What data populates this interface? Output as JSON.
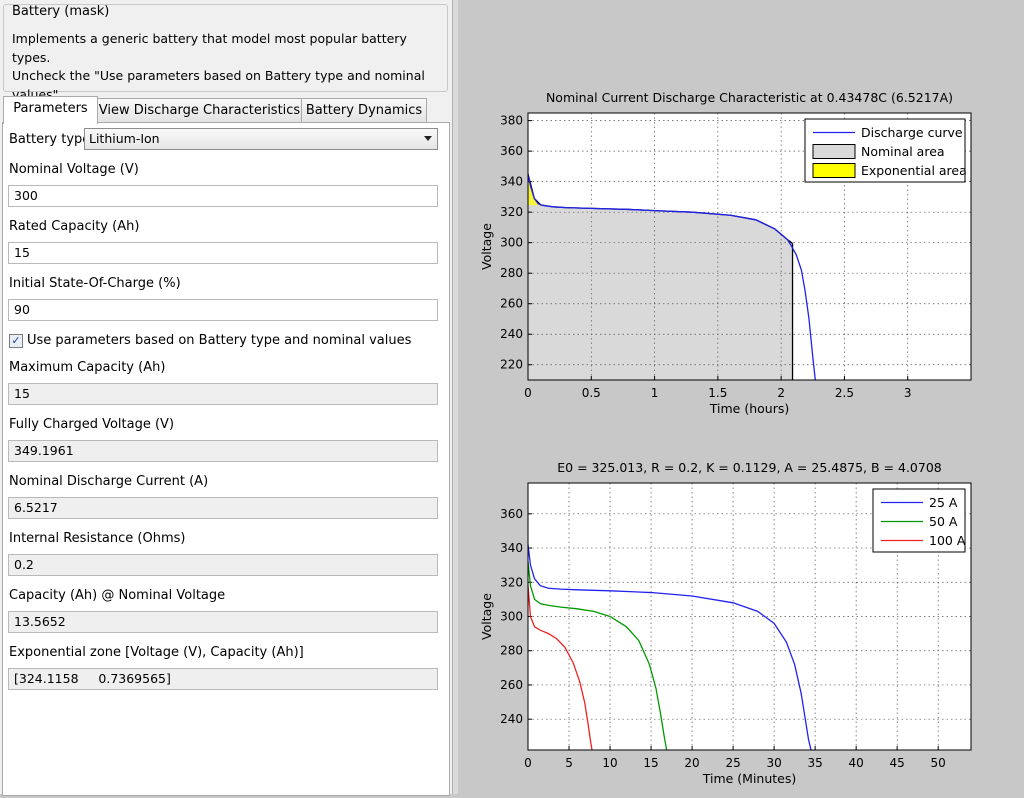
{
  "mask": {
    "title": "Battery (mask)",
    "description": "Implements a generic battery that model most popular battery types.\nUncheck the \"Use parameters based on Battery type and nominal values\"\nparameter to edit the discharge characteristics."
  },
  "tabs": [
    "Parameters",
    "View Discharge Characteristics",
    "Battery Dynamics"
  ],
  "params": {
    "battery_type_label": "Battery type",
    "battery_type_value": "Lithium-Ion",
    "nominal_voltage_label": "Nominal Voltage (V)",
    "nominal_voltage_value": "300",
    "rated_capacity_label": "Rated Capacity (Ah)",
    "rated_capacity_value": "15",
    "initial_soc_label": "Initial State-Of-Charge (%)",
    "initial_soc_value": "90",
    "use_params_label": "Use parameters based on Battery type and nominal values",
    "use_params_checked": true,
    "max_capacity_label": "Maximum Capacity (Ah)",
    "max_capacity_value": "15",
    "fully_charged_label": "Fully Charged Voltage (V)",
    "fully_charged_value": "349.1961",
    "nominal_current_label": "Nominal Discharge Current (A)",
    "nominal_current_value": "6.5217",
    "internal_resistance_label": "Internal Resistance (Ohms)",
    "internal_resistance_value": "0.2",
    "capacity_nominal_label": "Capacity (Ah) @ Nominal Voltage",
    "capacity_nominal_value": "13.5652",
    "exp_zone_label": "Exponential zone [Voltage (V), Capacity (Ah)]",
    "exp_zone_value": "[324.1158     0.7369565]"
  },
  "colors": {
    "blue": "#2222ee",
    "green": "#009900",
    "red": "#ee2222",
    "yellow": "#ffff00",
    "nominal_gray": "#d9d9d9"
  },
  "chart_data": [
    {
      "type": "line",
      "title": "Nominal Current Discharge Characteristic at 0.43478C (6.5217A)",
      "xlabel": "Time (hours)",
      "ylabel": "Voltage",
      "xlim": [
        0,
        3.5
      ],
      "ylim": [
        210,
        385
      ],
      "xticks": [
        0,
        0.5,
        1,
        1.5,
        2,
        2.5,
        3
      ],
      "yticks": [
        220,
        240,
        260,
        280,
        300,
        320,
        340,
        360,
        380
      ],
      "grid": true,
      "legend_position": "top-right",
      "legend": [
        {
          "label": "Discharge curve",
          "kind": "line",
          "color": "#2222ee"
        },
        {
          "label": "Nominal area",
          "kind": "box",
          "color": "#d9d9d9"
        },
        {
          "label": "Exponential area",
          "kind": "box",
          "color": "#ffff00"
        }
      ],
      "series": [
        {
          "name": "Discharge curve",
          "x": [
            0,
            0.02,
            0.05,
            0.08,
            0.11,
            0.15,
            0.2,
            0.3,
            0.5,
            0.8,
            1.0,
            1.3,
            1.6,
            1.8,
            1.95,
            2.05,
            2.08,
            2.12,
            2.16,
            2.19,
            2.22,
            2.25,
            2.27
          ],
          "y": [
            345,
            337,
            329,
            325.5,
            324.5,
            324,
            323.5,
            323,
            322.5,
            321.8,
            321,
            320,
            318,
            315,
            309,
            302,
            298,
            292,
            282,
            268,
            250,
            225,
            210
          ]
        }
      ],
      "exponential_area": {
        "x": [
          0,
          0.02,
          0.05,
          0.08,
          0.11
        ],
        "y": [
          345,
          337,
          329,
          325.5,
          324.5
        ]
      },
      "nominal_area": {
        "x": [
          0,
          0.05,
          0.1,
          0.2,
          0.3,
          0.5,
          0.8,
          1.0,
          1.3,
          1.6,
          1.8,
          1.95,
          2.05,
          2.09
        ],
        "y": [
          345,
          329,
          324.8,
          323.5,
          323,
          322.5,
          321.8,
          321,
          320,
          318,
          315,
          309,
          302,
          299.5
        ]
      },
      "nominal_capacity_marker_x": 2.09
    },
    {
      "type": "line",
      "title": "E0 = 325.013, R = 0.2, K = 0.1129, A = 25.4875, B = 4.0708",
      "xlabel": "Time (Minutes)",
      "ylabel": "Voltage",
      "xlim": [
        0,
        54
      ],
      "ylim": [
        222,
        378
      ],
      "xticks": [
        0,
        5,
        10,
        15,
        20,
        25,
        30,
        35,
        40,
        45,
        50
      ],
      "yticks": [
        240,
        260,
        280,
        300,
        320,
        340,
        360
      ],
      "grid": true,
      "legend_position": "top-right",
      "series": [
        {
          "name": "25 A",
          "color": "#2222ee",
          "x": [
            0,
            0.3,
            0.8,
            1.5,
            2.5,
            4,
            6,
            10,
            15,
            20,
            25,
            28,
            30,
            31.5,
            32.5,
            33.3,
            33.8,
            34.2,
            34.5
          ],
          "y": [
            342,
            330,
            322,
            318,
            316.5,
            316,
            315.6,
            315,
            314,
            312,
            308,
            303,
            296,
            285,
            272,
            255,
            240,
            228,
            222
          ]
        },
        {
          "name": "50 A",
          "color": "#009900",
          "x": [
            0,
            0.3,
            0.8,
            1.5,
            2.5,
            4,
            6,
            8,
            10,
            12,
            13.5,
            14.8,
            15.6,
            16.2,
            16.6,
            16.9
          ],
          "y": [
            332,
            318,
            310,
            307.5,
            306.5,
            305.5,
            304.5,
            303,
            300,
            294,
            286,
            272,
            258,
            242,
            230,
            222
          ]
        },
        {
          "name": "100 A",
          "color": "#ee2222",
          "x": [
            0,
            0.3,
            0.8,
            1.5,
            2.5,
            3.5,
            4.5,
            5.5,
            6.3,
            6.9,
            7.3,
            7.6,
            7.8
          ],
          "y": [
            318,
            300,
            294,
            292,
            290,
            287,
            282,
            273,
            262,
            250,
            238,
            228,
            222
          ]
        }
      ]
    }
  ]
}
